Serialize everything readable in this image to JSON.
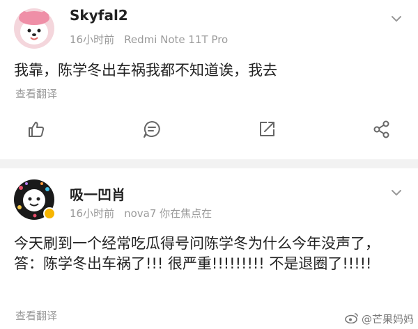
{
  "posts": [
    {
      "username": "Skyfal2",
      "time": "16小时前",
      "device": "Redmi Note 11T Pro",
      "content": "我靠，陈学冬出车祸我都不知道诶，我去",
      "translate": "查看翻译"
    },
    {
      "username": "吸一凹肖",
      "time": "16小时前",
      "device": "nova7 你在焦点在",
      "content": "今天刷到一个经常吃瓜得号问陈学冬为什么今年没声了，答：陈学冬出车祸了!!! 很严重!!!!!!!!! 不是退圈了!!!!!",
      "translate": "查看翻译"
    }
  ],
  "watermark": "@芒果妈妈",
  "icons": [
    "like-icon",
    "comment-icon",
    "repost-icon",
    "share-icon",
    "chevron-down-icon",
    "weibo-logo-icon"
  ],
  "colors": {
    "gray_text": "#9a9a9a",
    "separator": "#f2f2f2",
    "verified": "#f7b500"
  }
}
